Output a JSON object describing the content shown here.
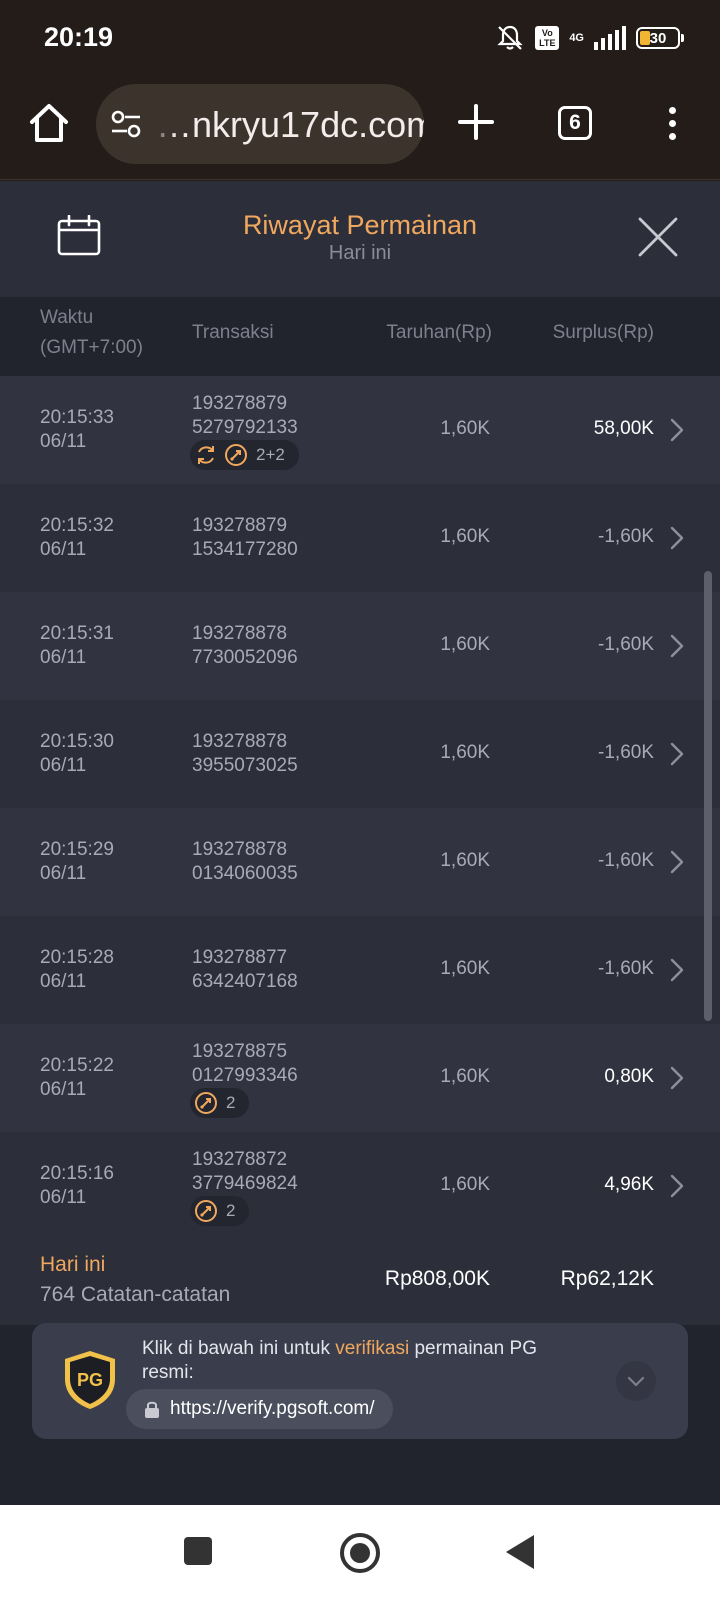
{
  "status_bar": {
    "time": "20:19",
    "network": "4G",
    "volte": "Vo LTE",
    "battery": "30"
  },
  "browser": {
    "url": "…nkryu17dc.com",
    "tab_count": "6"
  },
  "modal": {
    "title": "Riwayat Permainan",
    "subtitle": "Hari ini"
  },
  "table": {
    "columns": {
      "time_line1": "Waktu",
      "time_line2": "(GMT+7:00)",
      "transaction": "Transaksi",
      "bet": "Taruhan(Rp)",
      "surplus": "Surplus(Rp)"
    },
    "rows": [
      {
        "time": "20:15:33",
        "date": "06/11",
        "tx1": "193278879",
        "tx2": "5279792133",
        "bet": "1,60K",
        "surplus": "58,00K",
        "badge": "2+2"
      },
      {
        "time": "20:15:32",
        "date": "06/11",
        "tx1": "193278879",
        "tx2": "1534177280",
        "bet": "1,60K",
        "surplus": "-1,60K",
        "badge": ""
      },
      {
        "time": "20:15:31",
        "date": "06/11",
        "tx1": "193278878",
        "tx2": "7730052096",
        "bet": "1,60K",
        "surplus": "-1,60K",
        "badge": ""
      },
      {
        "time": "20:15:30",
        "date": "06/11",
        "tx1": "193278878",
        "tx2": "3955073025",
        "bet": "1,60K",
        "surplus": "-1,60K",
        "badge": ""
      },
      {
        "time": "20:15:29",
        "date": "06/11",
        "tx1": "193278878",
        "tx2": "0134060035",
        "bet": "1,60K",
        "surplus": "-1,60K",
        "badge": ""
      },
      {
        "time": "20:15:28",
        "date": "06/11",
        "tx1": "193278877",
        "tx2": "6342407168",
        "bet": "1,60K",
        "surplus": "-1,60K",
        "badge": ""
      },
      {
        "time": "20:15:22",
        "date": "06/11",
        "tx1": "193278875",
        "tx2": "0127993346",
        "bet": "1,60K",
        "surplus": "0,80K",
        "badge": "2"
      },
      {
        "time": "20:15:16",
        "date": "06/11",
        "tx1": "193278872",
        "tx2": "3779469824",
        "bet": "1,60K",
        "surplus": "4,96K",
        "badge": "2"
      }
    ]
  },
  "summary": {
    "label": "Hari ini",
    "count": "764 Catatan-catatan",
    "total_bet": "Rp808,00K",
    "total_surplus": "Rp62,12K"
  },
  "verify": {
    "logo": "PG",
    "text_before": "Klik di bawah ini untuk ",
    "text_highlight": "verifikasi",
    "text_after": " permainan PG resmi:",
    "link": "https://verify.pgsoft.com/"
  },
  "colors": {
    "accent": "#f0a85e",
    "background": "#21232d",
    "row_alt": "#313341"
  }
}
